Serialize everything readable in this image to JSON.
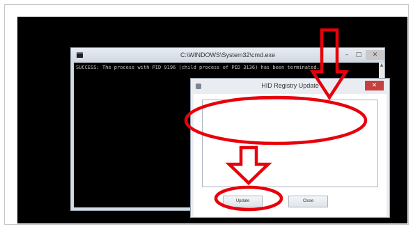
{
  "cmd_window": {
    "title": "C:\\WINDOWS\\System32\\cmd.exe",
    "minimize": "–",
    "maximize": "□",
    "close": "✕",
    "output": "SUCCESS: The process with PID 9196 (child process of PID 3136) has been terminated."
  },
  "dialog": {
    "title": "HID Registry Update",
    "close": "✕",
    "update_label": "Update",
    "close_label": "Close"
  },
  "annotations": {
    "color": "#e8000b",
    "marks": [
      "arrow-down",
      "highlight-ellipse",
      "arrow-down",
      "highlight-ellipse"
    ]
  }
}
